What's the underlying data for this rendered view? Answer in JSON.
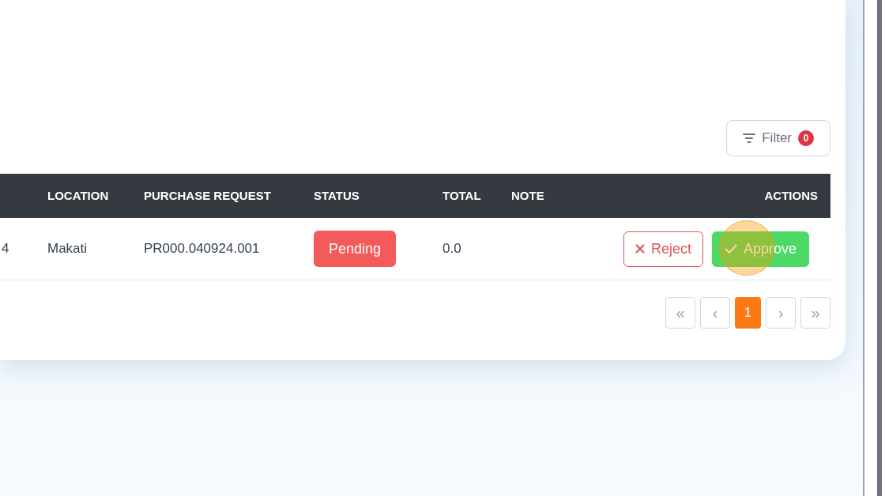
{
  "filter": {
    "label": "Filter",
    "count": "0"
  },
  "table": {
    "columns": [
      {
        "label": "LOCATION"
      },
      {
        "label": "PURCHASE REQUEST"
      },
      {
        "label": "STATUS"
      },
      {
        "label": "TOTAL"
      },
      {
        "label": "NOTE"
      },
      {
        "label": "ACTIONS"
      }
    ],
    "rows": [
      {
        "column_1": "4",
        "location": "Makati",
        "purchase_request": "PR000.040924.001",
        "status": "Pending",
        "total": "0.0",
        "actions": [
          {
            "kind": "reject",
            "label": "Reject"
          },
          {
            "kind": "approve",
            "label": "Approve"
          }
        ]
      }
    ]
  },
  "pagination": [
    {
      "label": "«",
      "selected": false
    },
    {
      "label": "‹",
      "selected": false
    },
    {
      "label": "1",
      "selected": true
    },
    {
      "label": "›",
      "selected": false
    },
    {
      "label": "»",
      "selected": false
    }
  ]
}
